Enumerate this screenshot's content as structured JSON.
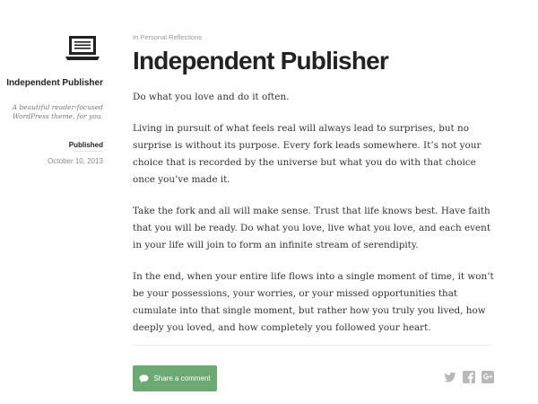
{
  "site": {
    "logo_icon": "laptop-icon",
    "title": "Independent Publisher",
    "description": "A beautiful reader-focused WordPress theme, for you."
  },
  "meta": {
    "published_label": "Published",
    "date": "October 10, 2013"
  },
  "post": {
    "category": "In Personal Reflections",
    "title": "Independent Publisher",
    "paragraphs": [
      "Do what you love and do it often.",
      "Living in pursuit of what feels real will always lead to surprises, but no surprise is without its purpose. Every fork leads somewhere. It’s not your choice that is recorded by the universe but what you do with that choice once you’ve made it.",
      "Take the fork and all will make sense. Trust that life knows best. Have faith that you will be ready. Do what you love, live what you love, and each event in your life will join to form an infinite stream of serendipity.",
      "In the end, when your entire life flows into a single moment of time, it won’t be your possessions, your worries, or your missed opportunities that cumulate into that single moment, but rather how you truly you lived, how deeply you loved, and how completely you followed your heart."
    ]
  },
  "footer": {
    "comment_button": "Share a comment",
    "comment_icon": "speech-bubble-icon",
    "share_icons": [
      "twitter-icon",
      "facebook-icon",
      "google-plus-icon"
    ]
  },
  "colors": {
    "accent_green": "#6daa73",
    "social_icon_gray": "#b8b8b8",
    "text": "#333333"
  }
}
